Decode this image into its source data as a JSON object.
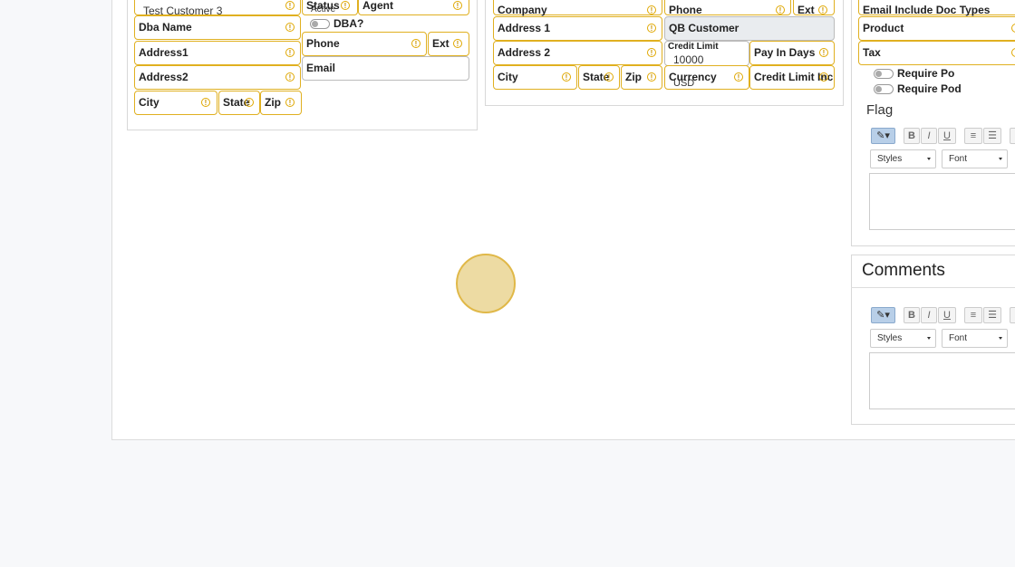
{
  "left_card": {
    "customer_value": "Test Customer 3",
    "status_label": "Status",
    "status_value": "Active",
    "agent_label": "Agent",
    "dba_name_label": "Dba Name",
    "dba_toggle_label": "DBA?",
    "address1_label": "Address1",
    "phone_label": "Phone",
    "ext_label": "Ext",
    "address2_label": "Address2",
    "email_label": "Email",
    "city_label": "City",
    "state_label": "State",
    "zip_label": "Zip"
  },
  "middle_card": {
    "company_label": "Company",
    "phone_label": "Phone",
    "ext_label": "Ext",
    "address1_label": "Address 1",
    "qb_customer_label": "QB Customer",
    "address2_label": "Address 2",
    "credit_limit_label": "Credit Limit",
    "credit_limit_value": "10000",
    "pay_in_days_label": "Pay In Days",
    "city_label": "City",
    "state_label": "State",
    "zip_label": "Zip",
    "currency_label": "Currency",
    "currency_value": "USD",
    "credit_limit_inc_label": "Credit Limit Inc"
  },
  "right_panel": {
    "email_doc_types_label": "Email Include Doc Types",
    "product_label": "Product",
    "tax_label": "Tax",
    "require_po_label": "Require Po",
    "require_pod_label": "Require Pod",
    "flag_title": "Flag",
    "comments_title": "Comments",
    "toolbar": {
      "bold": "B",
      "italic": "I",
      "underline": "U",
      "styles": "Styles",
      "font": "Font"
    }
  },
  "colors": {
    "required_border": "#e0b020",
    "cursor_fill": "#e8d28c"
  }
}
